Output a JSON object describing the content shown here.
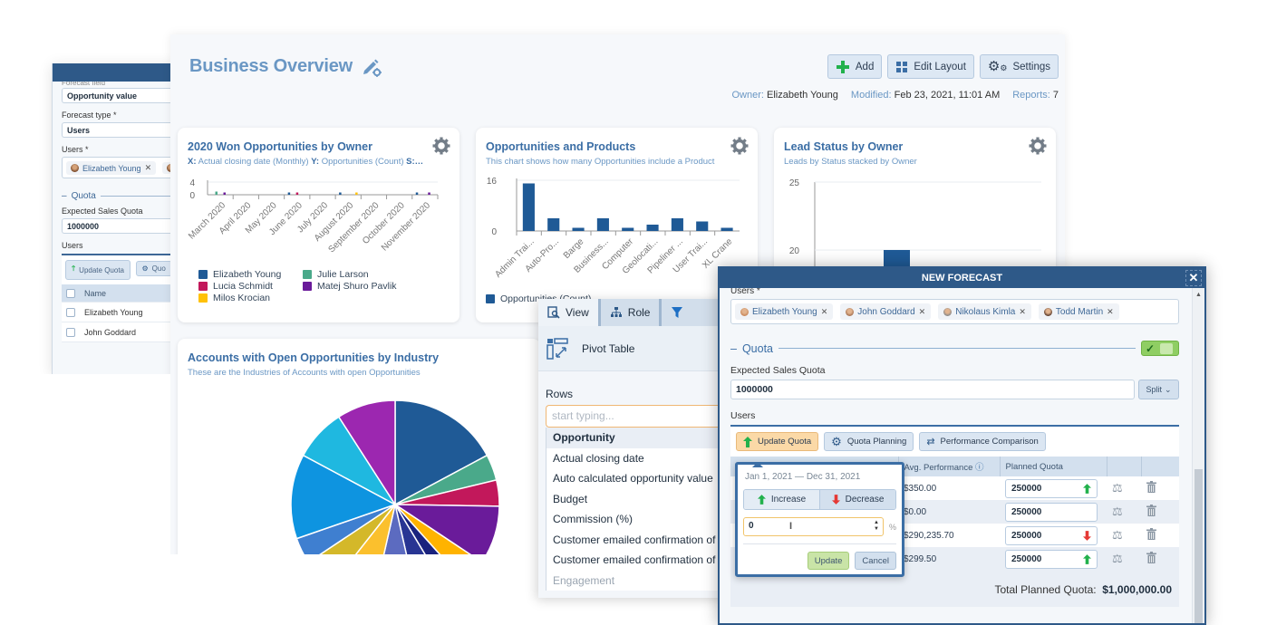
{
  "left_panel": {
    "forecast_field_value": "Opportunity value",
    "forecast_type_label": "Forecast type *",
    "forecast_type_value": "Users",
    "users_label": "Users *",
    "user_chip": "Elizabeth Young",
    "quota_section": "Quota",
    "expected_quota_label": "Expected Sales Quota",
    "expected_quota_value": "1000000",
    "users_table_label": "Users",
    "update_quota_button": "Update Quota",
    "quota_planning_button_partial": "Quo",
    "name_header": "Name",
    "rows": [
      "Elizabeth Young",
      "John Goddard"
    ]
  },
  "dashboard": {
    "title": "Business Overview",
    "toolbar": {
      "add": "Add",
      "edit_layout": "Edit Layout",
      "settings": "Settings"
    },
    "meta": {
      "owner_label": "Owner:",
      "owner": "Elizabeth Young",
      "modified_label": "Modified:",
      "modified": "Feb 23, 2021, 11:01 AM",
      "reports_label": "Reports:",
      "reports": "7"
    },
    "cards": {
      "won": {
        "title": "2020 Won Opportunities by Owner",
        "sub_x_key": "X:",
        "sub_x": "Actual closing date (Monthly)",
        "sub_y_key": "Y:",
        "sub_y": "Opportunities (Count)",
        "sub_s_key": "S:…"
      },
      "products": {
        "title": "Opportunities and Products",
        "subtitle": "This chart shows how many Opportunities include a Product"
      },
      "leads": {
        "title": "Lead Status by Owner",
        "subtitle": "Leads by Status stacked by Owner"
      },
      "accounts": {
        "title": "Accounts with Open Opportunities by Industry",
        "subtitle": "These are the Industries of Accounts with open Opportunities"
      }
    }
  },
  "chart_data": [
    {
      "type": "bar",
      "title": "2020 Won Opportunities by Owner",
      "xlabel": "Actual closing date (Monthly)",
      "ylabel": "Opportunities (Count)",
      "ylim": [
        0,
        4
      ],
      "y_ticks": [
        "4",
        "0"
      ],
      "categories": [
        "March 2020",
        "April 2020",
        "May 2020",
        "June 2020",
        "July 2020",
        "August 2020",
        "September 2020",
        "October 2020",
        "November 2020"
      ],
      "series": [
        {
          "name": "Elizabeth Young",
          "color": "#1f5a96",
          "values": [
            0,
            0,
            0,
            0.2,
            0,
            0.2,
            0,
            0,
            0.2
          ]
        },
        {
          "name": "Julie Larson",
          "color": "#4aa98a",
          "values": [
            1,
            0,
            0,
            0,
            0,
            0,
            0,
            0,
            0
          ]
        },
        {
          "name": "Lucia Schmidt",
          "color": "#c2185b",
          "values": [
            0,
            0,
            0,
            0.2,
            0,
            0,
            0,
            0,
            0
          ]
        },
        {
          "name": "Matej Shuro Pavlik",
          "color": "#6a1b9a",
          "values": [
            0.2,
            0,
            0,
            0,
            0,
            0,
            0,
            0,
            0.2
          ]
        },
        {
          "name": "Milos Krocian",
          "color": "#ffc107",
          "values": [
            0,
            0,
            0,
            0,
            0,
            0.2,
            0,
            0,
            0
          ]
        }
      ],
      "legend": "bottom"
    },
    {
      "type": "bar",
      "title": "Opportunities and Products",
      "ylim": [
        0,
        16
      ],
      "y_ticks": [
        "16",
        "0"
      ],
      "categories": [
        "Admin Trai...",
        "Auto-Pro...",
        "Barge",
        "Business...",
        "Computer",
        "Geolocati...",
        "Pipeliner ...",
        "User Trai...",
        "XL Crane"
      ],
      "series": [
        {
          "name": "Opportunities (Count)",
          "color": "#1f5a96",
          "values": [
            15,
            4,
            1,
            4,
            1,
            2,
            4,
            3,
            1
          ]
        }
      ],
      "legend": "bottom"
    },
    {
      "type": "bar",
      "title": "Lead Status by Owner",
      "ylim": [
        15,
        25
      ],
      "y_ticks": [
        "25",
        "20"
      ],
      "series": [
        {
          "name": "Leads",
          "color": "#1f5a96",
          "values": [
            20
          ]
        }
      ]
    },
    {
      "type": "pie",
      "title": "Accounts with Open Opportunities by Industry",
      "slices": [
        {
          "color": "#1f5a96",
          "value": 17
        },
        {
          "color": "#4aa98a",
          "value": 4
        },
        {
          "color": "#c2185b",
          "value": 4
        },
        {
          "color": "#6a1b9a",
          "value": 9
        },
        {
          "color": "#ffb300",
          "value": 4
        },
        {
          "color": "#1a237e",
          "value": 3
        },
        {
          "color": "#283593",
          "value": 5
        },
        {
          "color": "#5c6bc0",
          "value": 7
        },
        {
          "color": "#fbc02d",
          "value": 7
        },
        {
          "color": "#d4b829",
          "value": 5
        },
        {
          "color": "#3f7fd0",
          "value": 4
        },
        {
          "color": "#0e94e0",
          "value": 13
        },
        {
          "color": "#1fb8e0",
          "value": 8
        },
        {
          "color": "#9c27b0",
          "value": 9
        }
      ]
    }
  ],
  "pivot": {
    "tabs": [
      "View",
      "Role"
    ],
    "header": "Pivot Table",
    "rows_label": "Rows",
    "search_placeholder": "start typing...",
    "items": [
      {
        "label": "Opportunity",
        "group": true
      },
      {
        "label": "Actual closing date"
      },
      {
        "label": "Auto calculated opportunity value"
      },
      {
        "label": "Budget"
      },
      {
        "label": "Commission (%)"
      },
      {
        "label": "Customer emailed confirmation of"
      },
      {
        "label": "Customer emailed confirmation of"
      },
      {
        "label": "Engagement",
        "dim": true
      }
    ]
  },
  "dialog": {
    "title": "NEW FORECAST",
    "users_label": "Users *",
    "chips": [
      "Elizabeth Young",
      "John Goddard",
      "Nikolaus Kimla",
      "Todd Martin"
    ],
    "quota_section": "Quota",
    "expected_quota_label": "Expected Sales Quota",
    "expected_quota_value": "1000000",
    "split_label": "Split",
    "users_table_label": "Users",
    "buttons": {
      "update_quota": "Update Quota",
      "quota_planning": "Quota Planning",
      "performance_comparison": "Performance Comparison"
    },
    "table_headers": {
      "avg_performance": "Avg. Performance",
      "planned_quota": "Planned Quota"
    },
    "rows": [
      {
        "avg": "$350.00",
        "quota": "250000",
        "trend": "up"
      },
      {
        "avg": "$0.00",
        "quota": "250000",
        "trend": ""
      },
      {
        "avg": "$290,235.70",
        "quota": "250000",
        "trend": "down"
      },
      {
        "avg": "$299.50",
        "quota": "250000",
        "trend": "up"
      }
    ],
    "total_label": "Total Planned Quota:",
    "total_value": "$1,000,000.00"
  },
  "popup": {
    "date_range": "Jan 1, 2021 — Dec 31, 2021",
    "increase": "Increase",
    "decrease": "Decrease",
    "value": "0",
    "unit": "%",
    "update": "Update",
    "cancel": "Cancel"
  }
}
